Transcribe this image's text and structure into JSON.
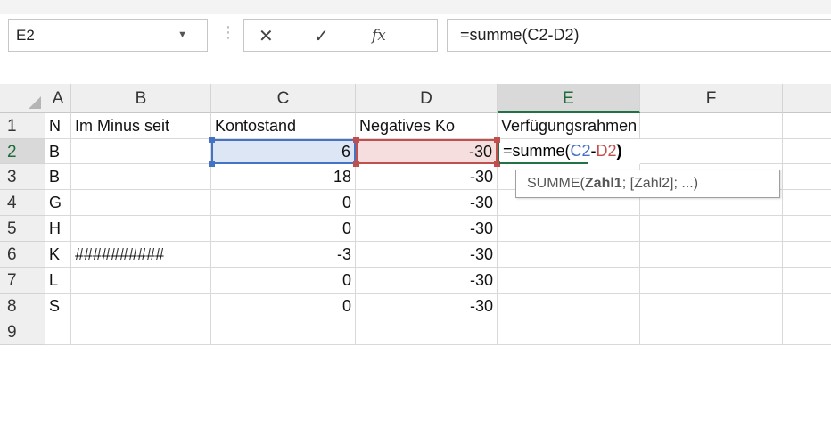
{
  "name_box": {
    "value": "E2",
    "arrow": "▼"
  },
  "formula_bar": {
    "cancel_icon": "✕",
    "enter_icon": "✓",
    "fx_icon": "fx",
    "formula": "=summe(C2-D2)"
  },
  "columns": [
    "A",
    "B",
    "C",
    "D",
    "E",
    "F"
  ],
  "rows": [
    "1",
    "2",
    "3",
    "4",
    "5",
    "6",
    "7",
    "8",
    "9"
  ],
  "cells": {
    "row1": {
      "A": "N",
      "B": "Im Minus seit",
      "C": "Kontostand",
      "D": "Negatives Ko",
      "E": "Verfügungsrahmen"
    },
    "row2": {
      "A": "B",
      "C": "6",
      "D": "-30",
      "E_parts": [
        "=summe(",
        "C2",
        "-",
        "D2",
        ")"
      ]
    },
    "row3": {
      "A": "B",
      "C": "18",
      "D": "-30"
    },
    "row4": {
      "A": "G",
      "C": "0",
      "D": "-30"
    },
    "row5": {
      "A": "H",
      "C": "0",
      "D": "-30"
    },
    "row6": {
      "A": "K",
      "B": "##########",
      "C": "-3",
      "D": "-30"
    },
    "row7": {
      "A": "L",
      "C": "0",
      "D": "-30"
    },
    "row8": {
      "A": "S",
      "C": "0",
      "D": "-30"
    }
  },
  "tooltip": {
    "fn": "SUMME(",
    "arg1": "Zahl1",
    "rest": "; [Zahl2]; ...)"
  },
  "colors": {
    "ref_c": "#4472c4",
    "ref_d": "#c0504d",
    "accent": "#217346"
  }
}
